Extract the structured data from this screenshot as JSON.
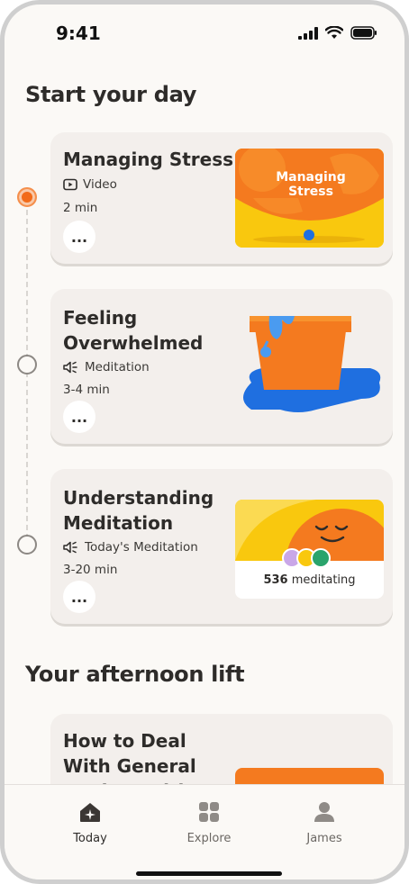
{
  "status_bar": {
    "time": "9:41"
  },
  "sections": [
    {
      "title": "Start your day"
    },
    {
      "title": "Your afternoon lift"
    }
  ],
  "cards": [
    {
      "title": "Managing Stress",
      "type": "Video",
      "duration": "2 min",
      "thumbnail_text": "Managing Stress",
      "more": "..."
    },
    {
      "title": "Feeling Overwhelmed",
      "type": "Meditation",
      "duration": "3-4 min",
      "more": "..."
    },
    {
      "title": "Understanding Meditation",
      "type": "Today's Meditation",
      "duration": "3-20 min",
      "meditating_count": "536",
      "meditating_label": "meditating",
      "more": "..."
    },
    {
      "title": "How to Deal With General Anxiety with An..."
    }
  ],
  "tabs": [
    {
      "label": "Today",
      "icon": "home-icon",
      "active": true
    },
    {
      "label": "Explore",
      "icon": "grid-icon",
      "active": false
    },
    {
      "label": "James",
      "icon": "profile-icon",
      "active": false
    }
  ],
  "colors": {
    "accent": "#f26b1a",
    "yellow": "#f9c80e",
    "blue": "#1f6fe0",
    "background": "#fbf9f6",
    "card": "#f3efec"
  }
}
